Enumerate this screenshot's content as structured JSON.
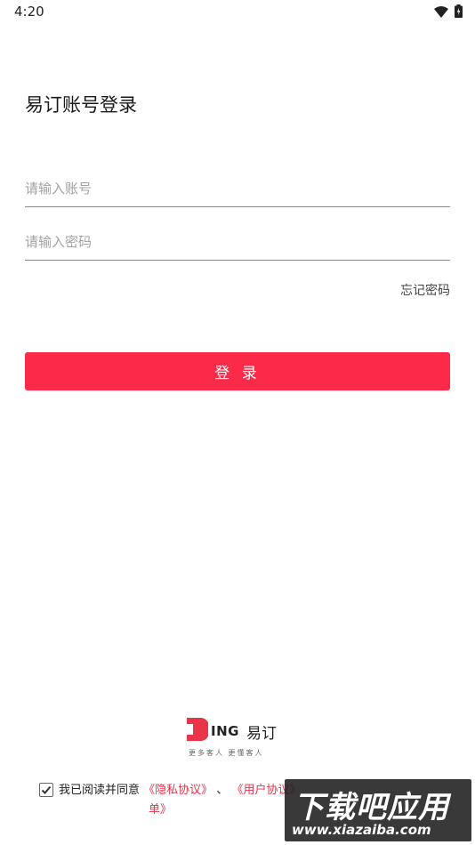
{
  "status_bar": {
    "time": "4:20"
  },
  "login": {
    "title": "易订账号登录",
    "account_placeholder": "请输入账号",
    "password_placeholder": "请输入密码",
    "forgot_label": "忘记密码",
    "login_label": "登 录"
  },
  "brand": {
    "logo_text": "ING",
    "logo_cn": "易订",
    "slogan": "更多客人  更懂客人"
  },
  "agreement": {
    "checked": true,
    "prefix": "我已阅读并同意",
    "privacy_link": "《隐私协议》",
    "separator": "、",
    "user_link": "《用户协议》",
    "line2": "单》"
  },
  "watermark": {
    "title": "下载吧应用",
    "url": "www.xiazaiba.com"
  },
  "colors": {
    "accent": "#fb2a49",
    "link": "#e8354a"
  }
}
